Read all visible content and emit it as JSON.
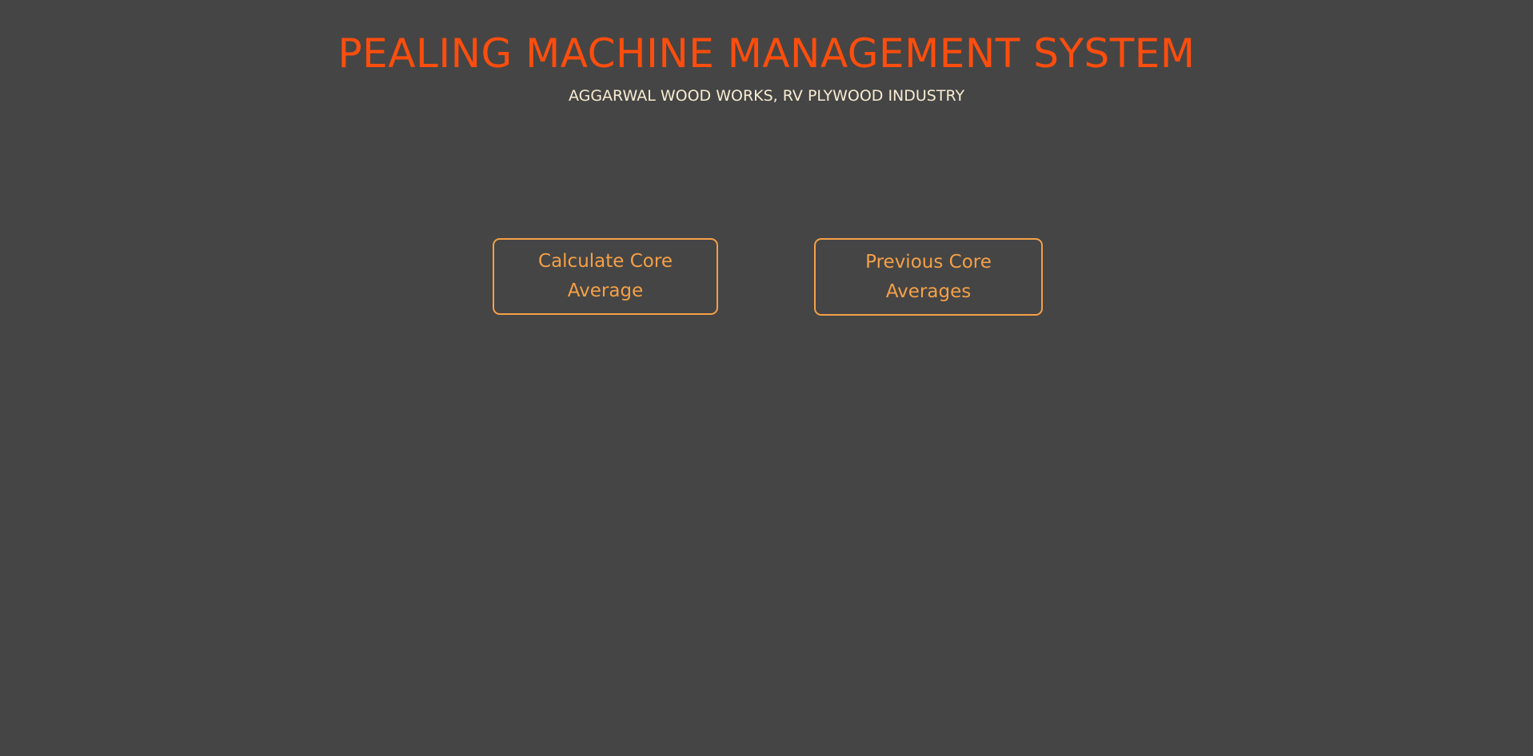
{
  "header": {
    "title": "PEALING MACHINE MANAGEMENT SYSTEM",
    "subtitle": "AGGARWAL WOOD WORKS, RV PLYWOOD INDUSTRY"
  },
  "actions": {
    "calculate_label": "Calculate Core Average",
    "previous_label": "Previous Core Averages"
  },
  "colors": {
    "background": "#454545",
    "title": "#ff4d0d",
    "subtitle": "#f8ecd2",
    "accent": "#f5a047"
  }
}
